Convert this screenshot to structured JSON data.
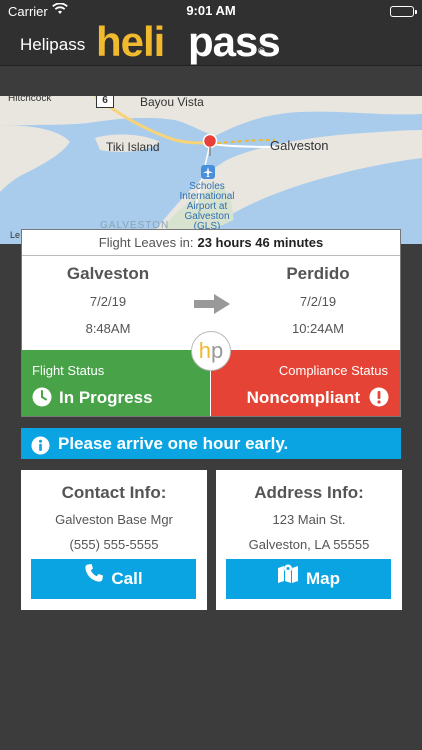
{
  "status_bar": {
    "carrier": "Carrier",
    "time": "9:01 AM"
  },
  "nav": {
    "title": "Helipass",
    "logo_heli": "heli",
    "logo_pass": "pass",
    "logo_mark": "®"
  },
  "map": {
    "labels": {
      "hitchcock": "Hitchcock",
      "bayou_vista": "Bayou Vista",
      "tiki_island": "Tiki Island",
      "galveston": "Galveston",
      "airport_line1": "Scholes",
      "airport_line2": "International",
      "airport_line3": "Airport at",
      "airport_line4": "Galveston",
      "airport_line5": "(GLS)",
      "galveston_faded": "GALVESTON",
      "legal": "Le",
      "route_shield": "6"
    }
  },
  "flight": {
    "leaves_label": "Flight Leaves in:",
    "leaves_value": "23 hours 46 minutes",
    "from": {
      "city": "Galveston",
      "date": "7/2/19",
      "time": "8:48AM"
    },
    "to": {
      "city": "Perdido",
      "date": "7/2/19",
      "time": "10:24AM"
    },
    "badge_h": "h",
    "badge_p": "p",
    "flight_status_label": "Flight Status",
    "flight_status_value": "In Progress",
    "compliance_status_label": "Compliance Status",
    "compliance_status_value": "Noncompliant"
  },
  "notice": {
    "text": "Please arrive one hour early."
  },
  "contact": {
    "title": "Contact Info:",
    "name": "Galveston Base Mgr",
    "phone": "(555) 555-5555",
    "button": "Call"
  },
  "address": {
    "title": "Address Info:",
    "street": "123 Main St.",
    "city": "Galveston, LA 55555",
    "button": "Map"
  },
  "colors": {
    "brand_yellow": "#f0b92e",
    "header_bg": "#303030",
    "page_bg": "#3c3c3c",
    "status_green": "#47a248",
    "status_red": "#e54335",
    "accent_blue": "#0aa4e3"
  },
  "icons": {
    "wifi": "wifi-icon",
    "battery": "battery-icon",
    "arrow": "right-arrow-icon",
    "clock": "clock-icon",
    "alert": "exclamation-circle-icon",
    "info": "info-circle-icon",
    "phone": "phone-icon",
    "map": "map-icon",
    "pin": "map-pin-icon",
    "airport": "airport-icon"
  }
}
